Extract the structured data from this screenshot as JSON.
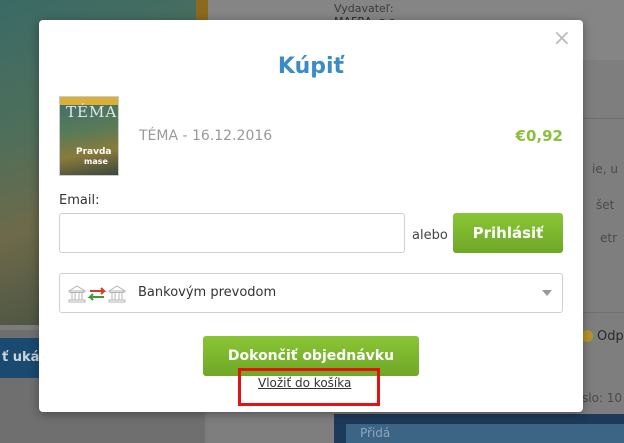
{
  "background": {
    "publisher_label": "Vydavateľ:",
    "publisher_value": "MAFRA, a.s.",
    "snippet_1": "ie, u",
    "snippet_2": "šet",
    "snippet_3": "etr",
    "odp_text": "Odp",
    "cislo_text": "slo: 10",
    "left_button_text": "ť uká",
    "bottom_panel_text": "Přidá"
  },
  "modal": {
    "close_symbol": "×",
    "title": "Kúpiť",
    "product": {
      "name": "TÉMA - 16.12.2016",
      "price": "€0,92",
      "cover_logo": "TÉMA",
      "cover_line_1": "Pravda",
      "cover_line_2": "mase"
    },
    "email_label": "Email:",
    "email_value": "",
    "or_text": "alebo",
    "login_button": "Prihlásiť",
    "payment_method": "Bankovým prevodom",
    "order_button": "Dokončiť objednávku",
    "add_to_cart_link": "Vložiť do košíka"
  },
  "colors": {
    "title_blue": "#3a8cc8",
    "button_green": "#7ab52f",
    "price_green": "#8bbf3a",
    "highlight_red": "#e31313"
  }
}
